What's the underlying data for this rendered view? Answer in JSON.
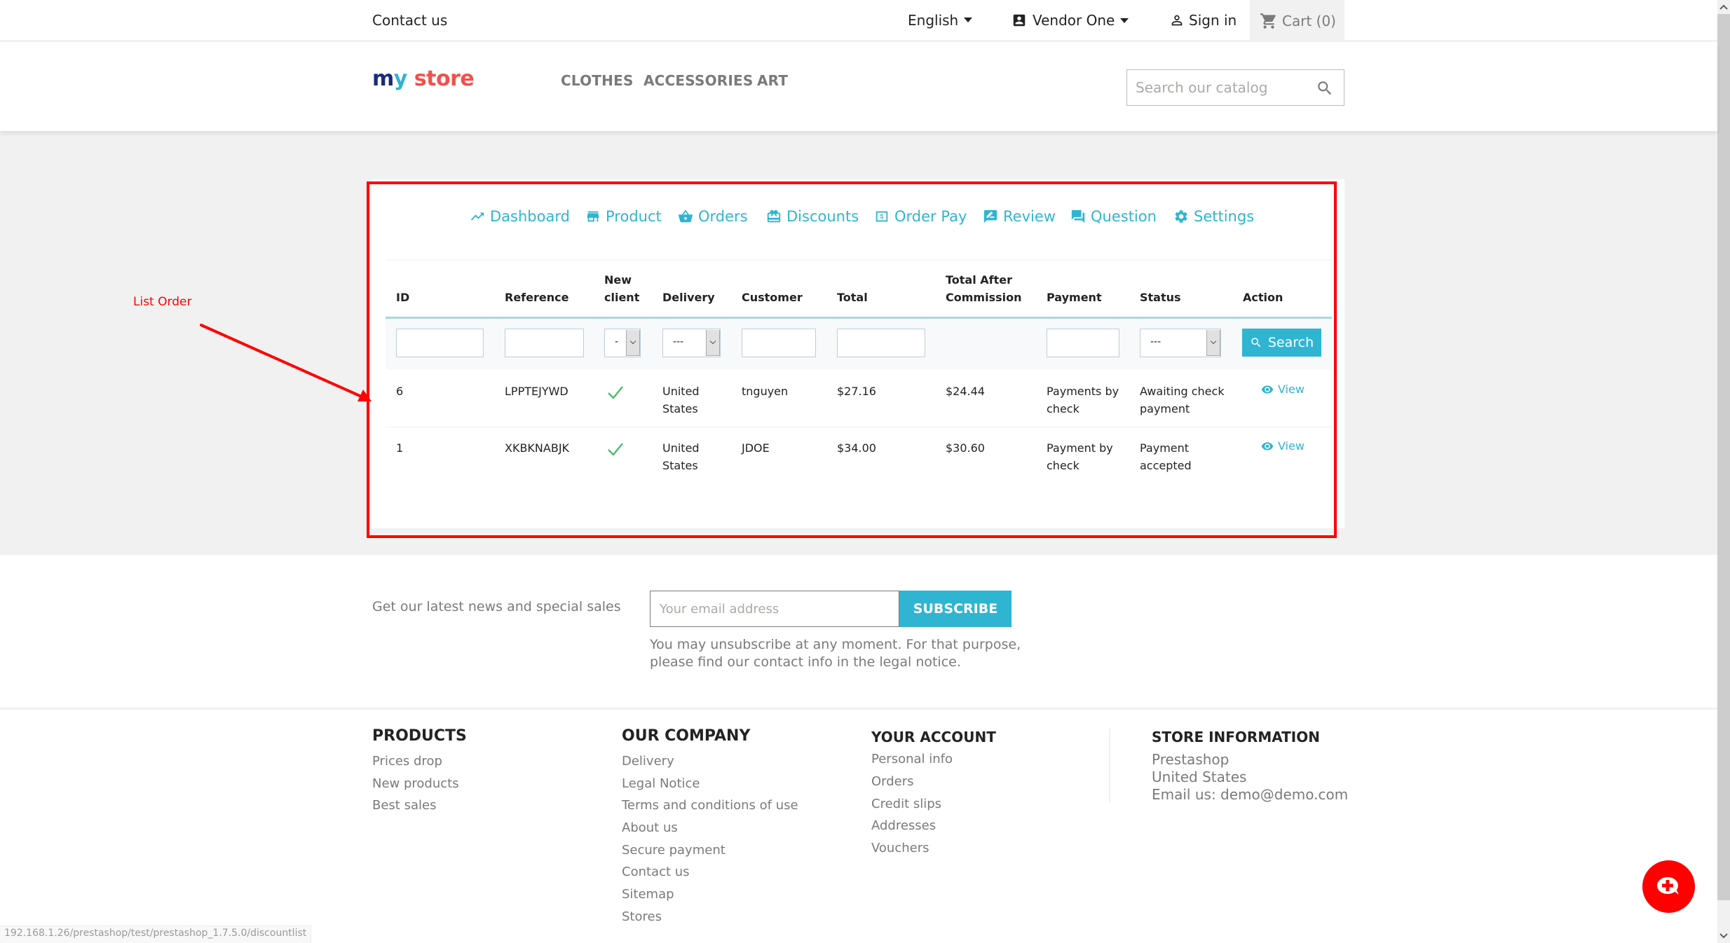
{
  "topbar": {
    "contact": "Contact us",
    "language": "English",
    "account": "Vendor One",
    "signin": "Sign in",
    "cart": "Cart (0)"
  },
  "header": {
    "logo_my": "m",
    "logo_y": "y",
    "logo_store": "store",
    "nav": [
      "CLOTHES",
      "ACCESSORIES",
      "ART"
    ],
    "search_placeholder": "Search our catalog"
  },
  "vendor_nav": [
    {
      "label": "Dashboard",
      "icon": "trending-up-icon"
    },
    {
      "label": "Product",
      "icon": "store-icon"
    },
    {
      "label": "Orders",
      "icon": "basket-icon"
    },
    {
      "label": "Discounts",
      "icon": "gift-card-icon"
    },
    {
      "label": "Order Pay",
      "icon": "dollar-receipt-icon"
    },
    {
      "label": "Review",
      "icon": "rate-review-icon"
    },
    {
      "label": "Question",
      "icon": "forum-icon"
    },
    {
      "label": "Settings",
      "icon": "gear-icon"
    }
  ],
  "table": {
    "headers": {
      "id": "ID",
      "reference": "Reference",
      "new_client_1": "New",
      "new_client_2": "client",
      "delivery": "Delivery",
      "customer": "Customer",
      "total": "Total",
      "tac_1": "Total After",
      "tac_2": "Commission",
      "payment": "Payment",
      "status": "Status",
      "action": "Action"
    },
    "filters": {
      "new_client_value": "-",
      "delivery_value": "---",
      "status_value": "---",
      "search_label": "Search"
    },
    "rows": [
      {
        "id": "6",
        "reference": "LPPTEJYWD",
        "new_client": true,
        "delivery_1": "United",
        "delivery_2": "States",
        "customer": "tnguyen",
        "total": "$27.16",
        "total_after_commission": "$24.44",
        "payment_1": "Payments by",
        "payment_2": "check",
        "status_1": "Awaiting check",
        "status_2": "payment",
        "action": "View"
      },
      {
        "id": "1",
        "reference": "XKBKNABJK",
        "new_client": true,
        "delivery_1": "United",
        "delivery_2": "States",
        "customer": "JDOE",
        "total": "$34.00",
        "total_after_commission": "$30.60",
        "payment_1": "Payment by",
        "payment_2": "check",
        "status_1": "Payment",
        "status_2": "accepted",
        "action": "View"
      }
    ]
  },
  "annotation": {
    "label": "List Order",
    "color": "#ff0000"
  },
  "newsletter": {
    "text": "Get our latest news and special sales",
    "placeholder": "Your email address",
    "button": "SUBSCRIBE",
    "note_1": "You may unsubscribe at any moment. For that purpose,",
    "note_2": "please find our contact info in the legal notice."
  },
  "footer": {
    "products": {
      "title": "PRODUCTS",
      "links": [
        "Prices drop",
        "New products",
        "Best sales"
      ]
    },
    "company": {
      "title": "OUR COMPANY",
      "links": [
        "Delivery",
        "Legal Notice",
        "Terms and conditions of use",
        "About us",
        "Secure payment",
        "Contact us",
        "Sitemap",
        "Stores"
      ]
    },
    "account": {
      "title": "YOUR ACCOUNT",
      "links": [
        "Personal info",
        "Orders",
        "Credit slips",
        "Addresses",
        "Vouchers"
      ]
    },
    "store": {
      "title": "STORE INFORMATION",
      "lines": [
        "Prestashop",
        "United States",
        "Email us: demo@demo.com"
      ]
    }
  },
  "status_url": "192.168.1.26/prestashop/test/prestashop_1.7.5.0/discountlist",
  "colors": {
    "accent": "#2fb5d2",
    "annotation": "#ff0000",
    "check": "#4cbb6c"
  }
}
